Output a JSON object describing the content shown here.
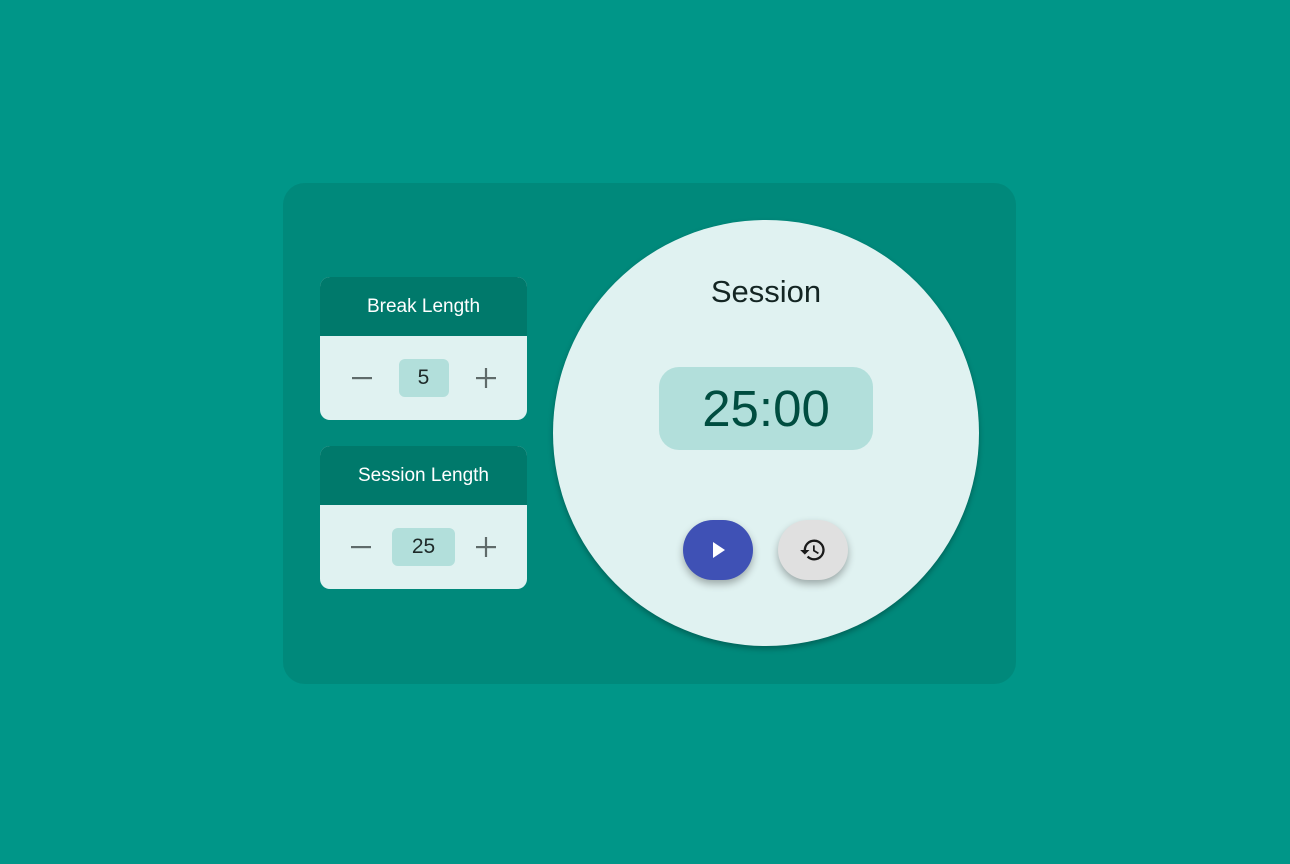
{
  "break_control": {
    "title": "Break Length",
    "value": "5",
    "decrement_icon": "minus-icon",
    "increment_icon": "plus-icon"
  },
  "session_control": {
    "title": "Session Length",
    "value": "25",
    "decrement_icon": "minus-icon",
    "increment_icon": "plus-icon"
  },
  "timer": {
    "mode_label": "Session",
    "time_display": "25:00",
    "play_icon": "play-icon",
    "reset_icon": "history-icon"
  },
  "colors": {
    "background": "#009688",
    "card": "#00897b",
    "header": "#00796b",
    "panel": "#e0f2f1",
    "value_box": "#b2dfdb",
    "play_button": "#3f51b5",
    "reset_button": "#e0e0e0"
  }
}
